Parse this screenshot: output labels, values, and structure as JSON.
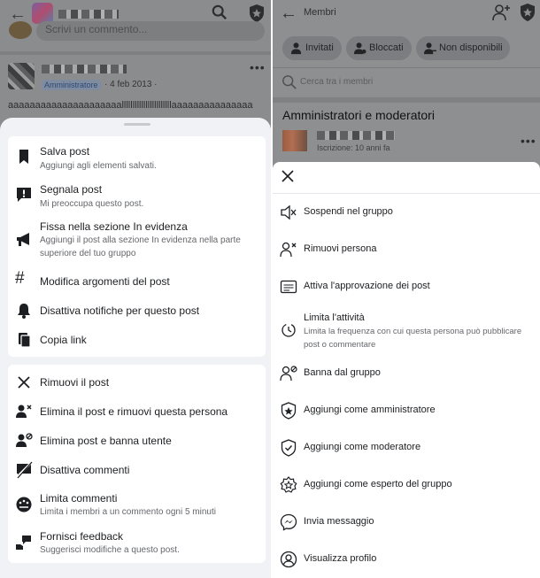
{
  "left": {
    "post": {
      "comment_placeholder": "Scrivi un commento...",
      "author_badge": "Amministratore",
      "date": "· 4 feb 2013 ·",
      "body": "aaaaaaaaaaaaaaaaaaaaalllllllllllllllllllllllaaaaaaaaaaaaaaa"
    },
    "menu_group1": [
      {
        "label": "Salva post",
        "sub": "Aggiungi agli elementi salvati.",
        "icon": "bookmark-icon"
      },
      {
        "label": "Segnala post",
        "sub": "Mi preoccupa questo post.",
        "icon": "report-icon"
      },
      {
        "label": "Fissa nella sezione In evidenza",
        "sub": "Aggiungi il post alla sezione In evidenza nella parte superiore del tuo gruppo",
        "icon": "megaphone-icon"
      },
      {
        "label": "Modifica argomenti del post",
        "icon": "hashtag-icon"
      },
      {
        "label": "Disattiva notifiche per questo post",
        "icon": "bell-icon"
      },
      {
        "label": "Copia link",
        "icon": "copy-icon"
      }
    ],
    "menu_group2": [
      {
        "label": "Rimuovi il post",
        "icon": "close-icon"
      },
      {
        "label": "Elimina il post e rimuovi questa persona",
        "icon": "remove-person-icon"
      },
      {
        "label": "Elimina post e banna utente",
        "icon": "ban-person-icon"
      },
      {
        "label": "Disattiva commenti",
        "icon": "comment-off-icon"
      },
      {
        "label": "Limita commenti",
        "sub": "Limita i membri a un commento ogni 5 minuti",
        "icon": "limit-comments-icon"
      },
      {
        "label": "Fornisci feedback",
        "sub": "Suggerisci modifiche a questo post.",
        "icon": "feedback-icon"
      }
    ]
  },
  "right": {
    "header_title": "Membri",
    "chips": [
      {
        "label": "Invitati",
        "icon": "person-icon"
      },
      {
        "label": "Bloccati",
        "icon": "person-block-icon"
      },
      {
        "label": "Non disponibili",
        "icon": "person-unavailable-icon"
      }
    ],
    "search_placeholder": "Cerca tra i membri",
    "section_title": "Amministratori e moderatori",
    "member_sub": "Iscrizione: 10 anni fa",
    "menu": [
      {
        "label": "Sospendi nel gruppo",
        "icon": "mute-icon"
      },
      {
        "label": "Rimuovi persona",
        "icon": "remove-person-icon"
      },
      {
        "label": "Attiva l'approvazione dei post",
        "icon": "approval-icon"
      },
      {
        "label": "Limita l'attività",
        "sub": "Limita la frequenza con cui questa persona può pubblicare post o commentare",
        "icon": "timer-icon"
      },
      {
        "label": "Banna dal gruppo",
        "icon": "ban-person-icon"
      },
      {
        "label": "Aggiungi come amministratore",
        "icon": "admin-shield-icon"
      },
      {
        "label": "Aggiungi come moderatore",
        "icon": "moderator-shield-icon"
      },
      {
        "label": "Aggiungi come esperto del gruppo",
        "icon": "expert-badge-icon"
      },
      {
        "label": "Invia messaggio",
        "icon": "messenger-icon"
      },
      {
        "label": "Visualizza profilo",
        "icon": "profile-icon"
      }
    ]
  }
}
